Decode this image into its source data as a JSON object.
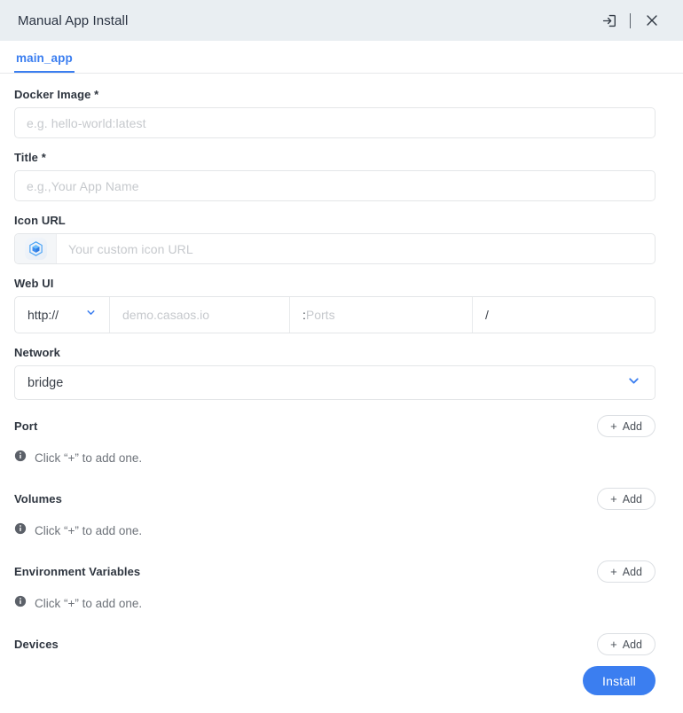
{
  "window": {
    "title": "Manual App Install",
    "actions": [
      {
        "name": "import-icon",
        "label": ""
      },
      {
        "name": "close-icon",
        "label": ""
      }
    ]
  },
  "tabs": [
    {
      "label": "main_app",
      "active": true
    }
  ],
  "form": {
    "docker_image": {
      "label": "Docker Image *",
      "placeholder": "e.g. hello-world:latest",
      "value": ""
    },
    "title": {
      "label": "Title *",
      "placeholder": "e.g.,Your App Name",
      "value": ""
    },
    "icon_url": {
      "label": "Icon URL",
      "placeholder": "Your custom icon URL",
      "value": ""
    },
    "web_ui": {
      "label": "Web UI",
      "protocol": "http://",
      "host_placeholder": "demo.casaos.io",
      "port_prefix": ":",
      "port_placeholder": "Ports",
      "path_prefix": "/",
      "path_value": ""
    },
    "network": {
      "label": "Network",
      "value": "bridge"
    }
  },
  "sections": [
    {
      "label": "Port",
      "add_label": "Add",
      "add_plus": "+",
      "hint": "Click “+” to add one.",
      "has_hint": true
    },
    {
      "label": "Volumes",
      "add_label": "Add",
      "add_plus": "+",
      "hint": "Click “+” to add one.",
      "has_hint": true
    },
    {
      "label": "Environment Variables",
      "add_label": "Add",
      "add_plus": "+",
      "hint": "Click “+” to add one.",
      "has_hint": true
    },
    {
      "label": "Devices",
      "add_label": "Add",
      "add_plus": "+",
      "hint": "",
      "has_hint": false
    }
  ],
  "footer": {
    "install_label": "Install"
  },
  "colors": {
    "accent": "#3b7ef0",
    "titlebar_bg": "#e9eef2",
    "title_text": "#2a3342",
    "label_text": "#2f3640",
    "placeholder": "#c6c9cd",
    "border": "#e4e6e8",
    "hint_text": "#6e737a"
  }
}
